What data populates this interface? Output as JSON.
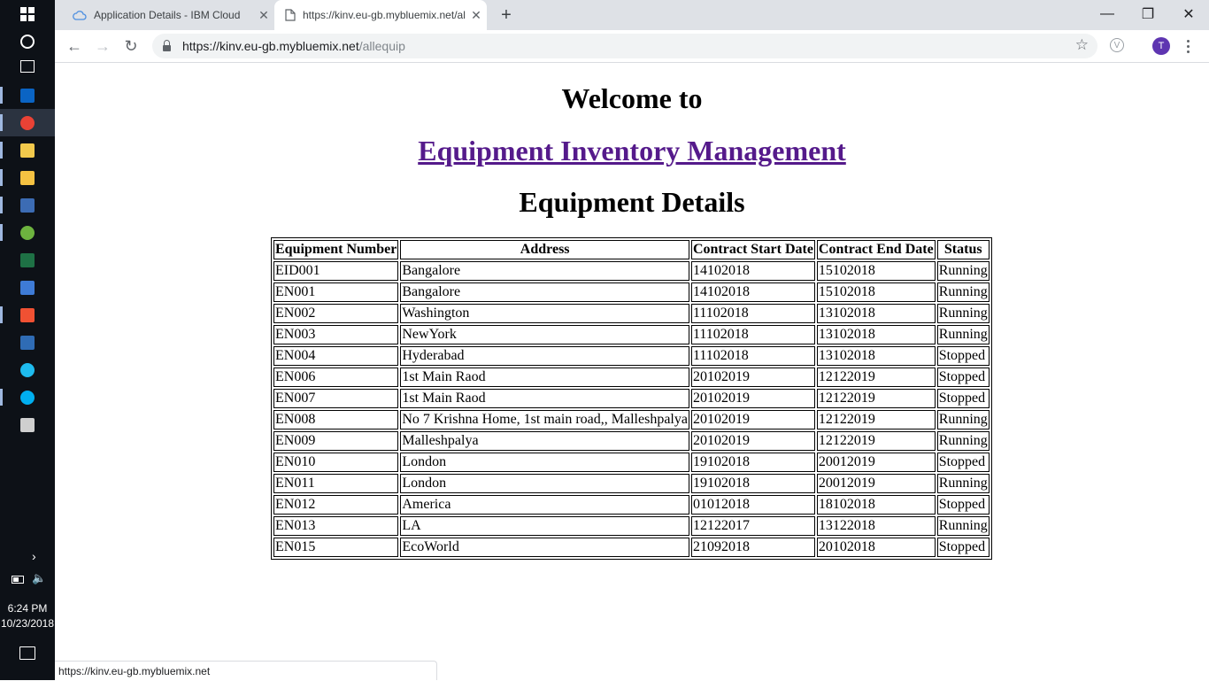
{
  "taskbar": {
    "icons": [
      {
        "name": "start-button",
        "color": "#ffffff"
      },
      {
        "name": "cortana-icon",
        "color": "#ffffff"
      },
      {
        "name": "task-view-icon",
        "color": "#ffffff"
      },
      {
        "name": "outlook-icon",
        "color": "#0a64c4"
      },
      {
        "name": "chrome-icon",
        "color": "#e94235"
      },
      {
        "name": "notepad-icon",
        "color": "#f2c94c"
      },
      {
        "name": "file-explorer-icon",
        "color": "#f5c242"
      },
      {
        "name": "eclipse-icon",
        "color": "#3c6cb4"
      },
      {
        "name": "spring-tool-icon",
        "color": "#6db33f"
      },
      {
        "name": "excel-icon",
        "color": "#1e7145"
      },
      {
        "name": "paint-icon",
        "color": "#3e7bd6"
      },
      {
        "name": "git-icon",
        "color": "#f05133"
      },
      {
        "name": "powershell-icon",
        "color": "#2f6cb5"
      },
      {
        "name": "internet-explorer-icon",
        "color": "#1ebbee"
      },
      {
        "name": "skype-icon",
        "color": "#00aff0"
      },
      {
        "name": "command-prompt-icon",
        "color": "#cfcfcf"
      }
    ],
    "time": "6:24 PM",
    "date": "10/23/2018"
  },
  "browser": {
    "tabs": [
      {
        "title": "Application Details - IBM Cloud",
        "icon": "cloud-icon"
      },
      {
        "title": "https://kinv.eu-gb.mybluemix.net/allequip",
        "icon": "page-icon"
      }
    ],
    "url_host": "https://kinv.eu-gb.mybluemix.net",
    "url_path": "/allequip",
    "avatar_letter": "T",
    "status_url": "https://kinv.eu-gb.mybluemix.net"
  },
  "page": {
    "welcome": "Welcome to",
    "app_link": "Equipment Inventory Management",
    "section_title": "Equipment Details",
    "columns": [
      "Equipment Number",
      "Address",
      "Contract Start Date",
      "Contract End Date",
      "Status"
    ],
    "rows": [
      [
        "EID001",
        "Bangalore",
        "14102018",
        "15102018",
        "Running"
      ],
      [
        "EN001",
        "Bangalore",
        "14102018",
        "15102018",
        "Running"
      ],
      [
        "EN002",
        "Washington",
        "11102018",
        "13102018",
        "Running"
      ],
      [
        "EN003",
        "NewYork",
        "11102018",
        "13102018",
        "Running"
      ],
      [
        "EN004",
        "Hyderabad",
        "11102018",
        "13102018",
        "Stopped"
      ],
      [
        "EN006",
        "1st Main Raod",
        "20102019",
        "12122019",
        "Stopped"
      ],
      [
        "EN007",
        "1st Main Raod",
        "20102019",
        "12122019",
        "Stopped"
      ],
      [
        "EN008",
        "No 7 Krishna Home, 1st main road,, Malleshpalya",
        "20102019",
        "12122019",
        "Running"
      ],
      [
        "EN009",
        "Malleshpalya",
        "20102019",
        "12122019",
        "Running"
      ],
      [
        "EN010",
        "London",
        "19102018",
        "20012019",
        "Stopped"
      ],
      [
        "EN011",
        "London",
        "19102018",
        "20012019",
        "Running"
      ],
      [
        "EN012",
        "America",
        "01012018",
        "18102018",
        "Stopped"
      ],
      [
        "EN013",
        "LA",
        "12122017",
        "13122018",
        "Running"
      ],
      [
        "EN015",
        "EcoWorld",
        "21092018",
        "20102018",
        "Stopped"
      ]
    ]
  }
}
